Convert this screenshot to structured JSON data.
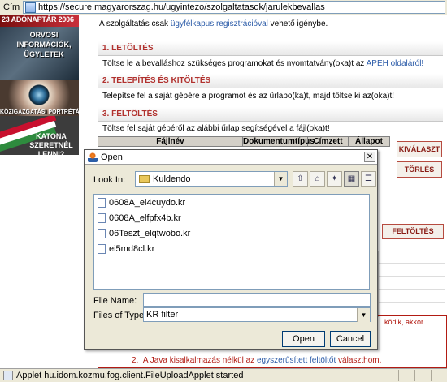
{
  "browser": {
    "address_label": "Cím",
    "url": "https://secure.magyarorszag.hu/ugyintezo/szolgaltatasok/jarulekbevallas"
  },
  "banners": {
    "year_tag": "23 ADÓNAPTÁR 2006",
    "banner1": "ORVOSI INFORMÁCIÓK, ÜGYLETEK",
    "banner2": "KÖZIGAZGATÁSI PORTRÉTÁR",
    "banner3": "KATONA SZERETNÉL LENNI?"
  },
  "page": {
    "intro_before": "A szolgáltatás csak ",
    "intro_link": "ügyfélkapus regisztrációval",
    "intro_after": " vehető igénybe.",
    "sections": [
      {
        "title": "1. LETÖLTÉS",
        "text_before": "Töltse le a bevalláshoz szükséges programokat és nyomtatvány(oka)t az ",
        "text_link": "APEH oldaláról!"
      },
      {
        "title": "2. TELEPÍTÉS ÉS KITÖLTÉS",
        "text": "Telepítse fel a saját gépére a programot és az űrlapo(ka)t, majd töltse ki az(oka)t!"
      },
      {
        "title": "3. FELTÖLTÉS",
        "text": "Töltse fel saját gépéről az alábbi űrlap segítségével a fájl(oka)t!"
      }
    ],
    "table_headers": [
      "Fájlnév",
      "Dokumentumtípus",
      "Címzett",
      "Állapot"
    ],
    "buttons": {
      "select": "KIVÁLASZT",
      "delete": "TÖRLÉS",
      "upload": "FELTÖLTÉS"
    },
    "notice_right": "ködik, akkor",
    "notice_line_num": "2.",
    "notice_line_before": "A Java kisalkalmazás nélkül az ",
    "notice_line_link": "egyszerűsített feltöltőt",
    "notice_line_after": " választhom."
  },
  "dialog": {
    "title": "Open",
    "close_symbol": "✕",
    "look_in_label": "Look In:",
    "look_in_value": "Kuldendo",
    "files": [
      "0608A_el4cuydo.kr",
      "0608A_elfpfx4b.kr",
      "06Teszt_elqtwobo.kr",
      "ei5md8cl.kr"
    ],
    "file_name_label": "File Name:",
    "file_name_value": "",
    "files_of_type_label": "Files of Type:",
    "files_of_type_value": "KR filter",
    "open_label": "Open",
    "cancel_label": "Cancel"
  },
  "status": {
    "text": "Applet hu.idom.kozmu.fog.client.FileUploadApplet started"
  }
}
